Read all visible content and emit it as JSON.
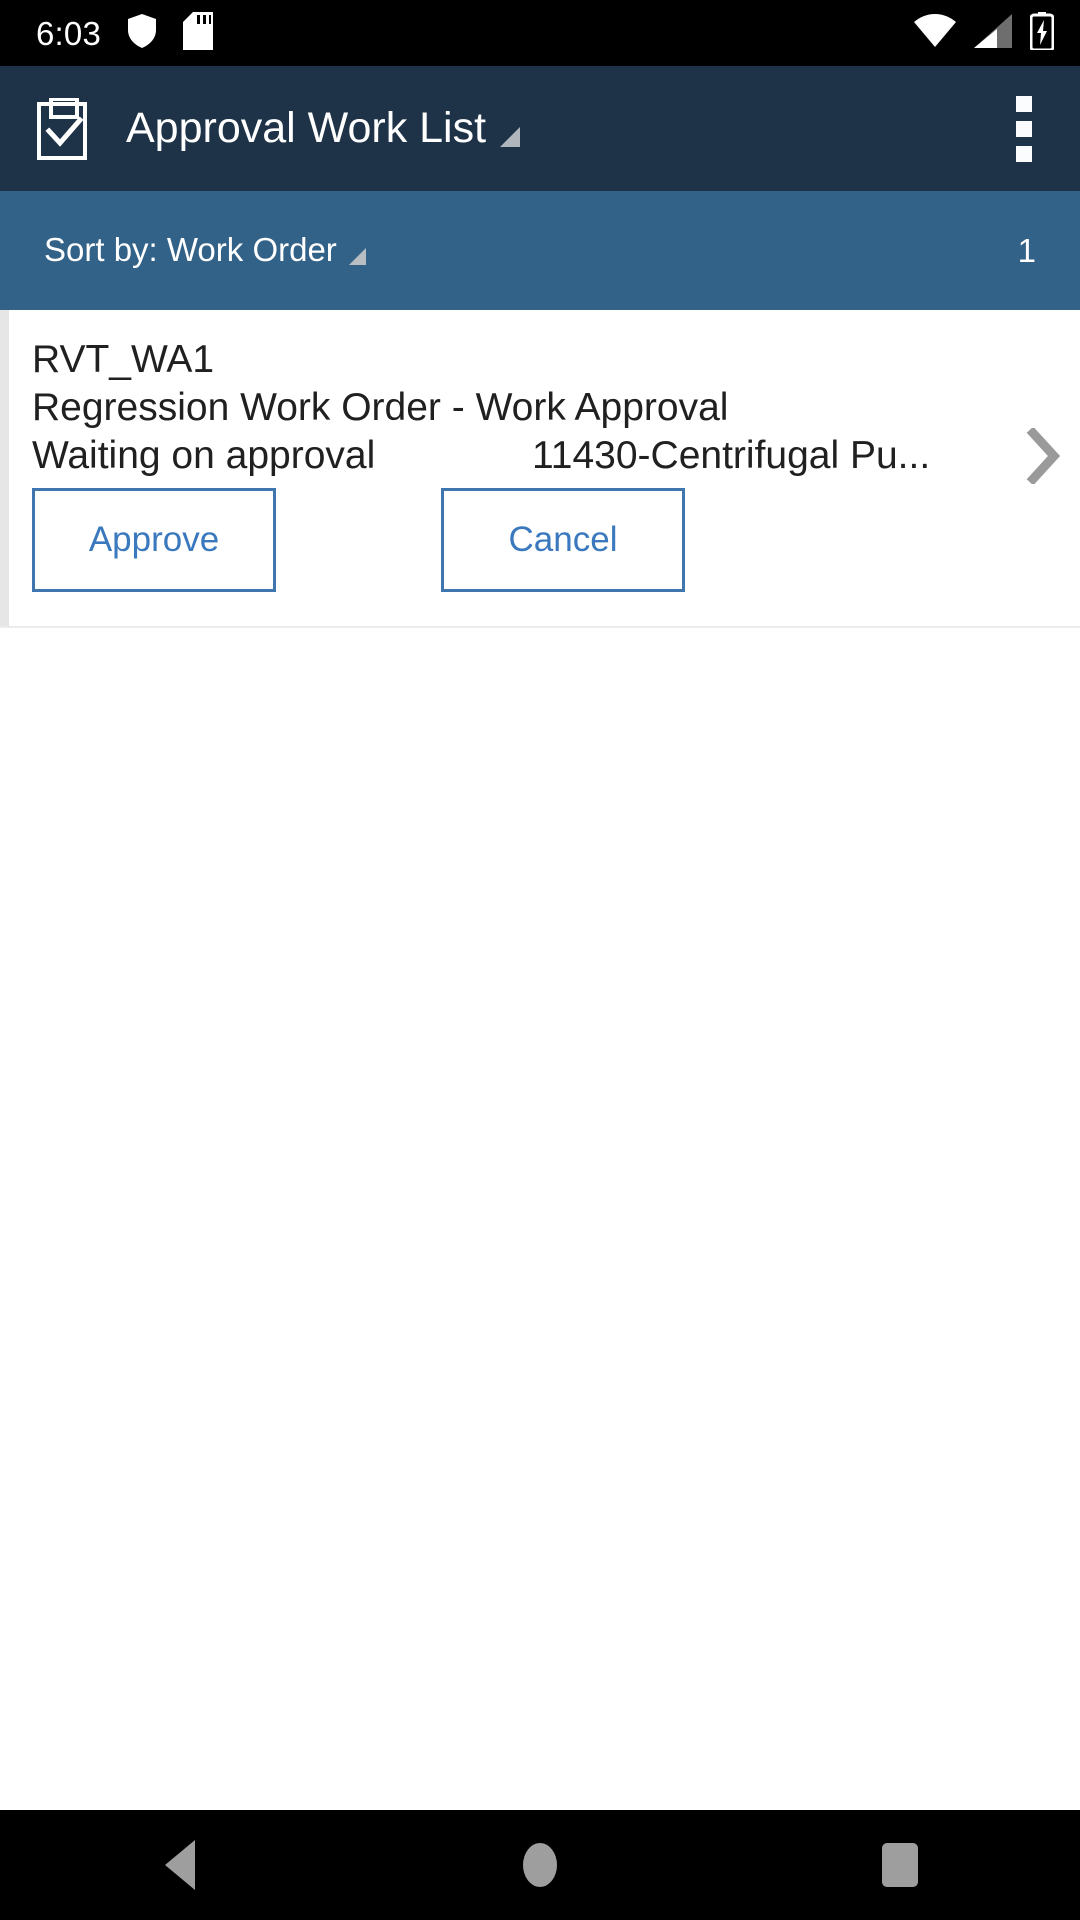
{
  "status_bar": {
    "time": "6:03",
    "icons_left": [
      "shield-icon",
      "sd-card-icon"
    ],
    "icons_right": [
      "wifi-icon",
      "cellular-signal-icon",
      "battery-charging-icon"
    ],
    "background_color": "#000000"
  },
  "app_bar": {
    "icon": "clipboard-check-icon",
    "title": "Approval Work List",
    "dropdown_indicator": "corner-triangle",
    "overflow_menu": "more-vertical-icon",
    "background_color": "#1e3347"
  },
  "sort_bar": {
    "label": "Sort by: Work Order",
    "dropdown_indicator": "corner-triangle",
    "count": "1",
    "background_color": "#336288"
  },
  "list": {
    "items": [
      {
        "work_order": "RVT_WA1",
        "description": "Regression Work Order - Work Approval",
        "status": "Waiting on approval",
        "asset": "11430-Centrifugal Pu...",
        "approve_label": "Approve",
        "cancel_label": "Cancel",
        "chevron": "chevron-right-icon"
      }
    ]
  },
  "nav_bar": {
    "back": "back-triangle-icon",
    "home": "home-circle-icon",
    "recents": "recents-square-icon",
    "background_color": "#000000"
  },
  "colors": {
    "header": "#1e3347",
    "sort_bar": "#336288",
    "accent_blue": "#3a79bd",
    "button_border": "#3f76ad",
    "text_primary": "#202020",
    "chevron_gray": "#9a9a9a"
  }
}
